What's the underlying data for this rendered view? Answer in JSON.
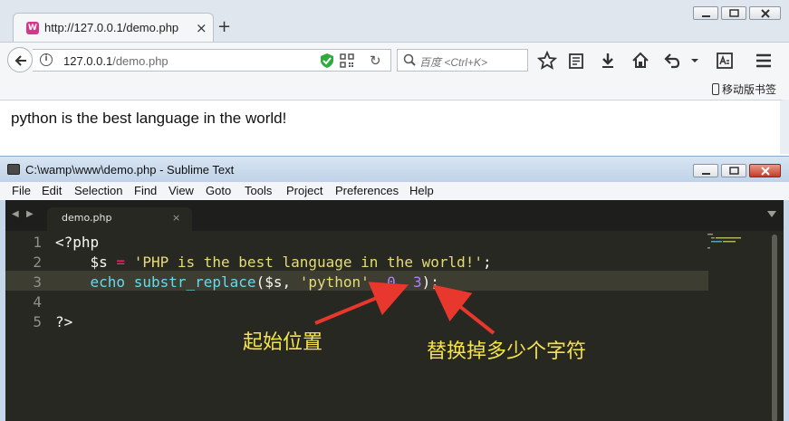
{
  "browser": {
    "tab_title": "http://127.0.0.1/demo.php",
    "favicon_glyph": "W",
    "url_host": "127.0.0.1",
    "url_path": "/demo.php",
    "search_placeholder": "百度 <Ctrl+K>",
    "bookmark_mobile": "移动版书签",
    "page_text": "python is the best language in the world!",
    "icons": [
      "back-icon",
      "info-icon",
      "shield-icon",
      "qr-code-icon",
      "reload-icon",
      "search-icon",
      "star-icon",
      "reader-list-icon",
      "download-icon",
      "home-icon",
      "undo-icon",
      "chevron-down-icon",
      "reader-view-icon",
      "hamburger-menu-icon"
    ]
  },
  "editor": {
    "window_title": "C:\\wamp\\www\\demo.php - Sublime Text",
    "menu": [
      "File",
      "Edit",
      "Selection",
      "Find",
      "View",
      "Goto",
      "Tools",
      "Project",
      "Preferences",
      "Help"
    ],
    "tab_name": "demo.php",
    "tab_close": "×",
    "line_numbers": [
      "1",
      "2",
      "3",
      "4",
      "5"
    ],
    "code": {
      "line1": "<?php",
      "line2_var": "    $s",
      "line2_eq": " = ",
      "line2_str": "'PHP is the best language in the world!'",
      "line2_end": ";",
      "line3_echo": "    echo",
      "line3_fn": " substr_replace",
      "line3_args": "($s, ",
      "line3_str": "'python'",
      "line3_comma1": ", ",
      "line3_num1": "0",
      "line3_comma2": ", ",
      "line3_num2": "3",
      "line3_end": ");",
      "line5": "?>"
    },
    "annotations": {
      "start_position": "起始位置",
      "replace_count": "替换掉多少个字符"
    },
    "colors": {
      "background": "#272822",
      "keyword": "#f92672",
      "function": "#66d9ef",
      "string": "#e6db74",
      "number": "#ae81ff",
      "annotation": "#f5e34b",
      "arrow": "#e8372c"
    }
  }
}
